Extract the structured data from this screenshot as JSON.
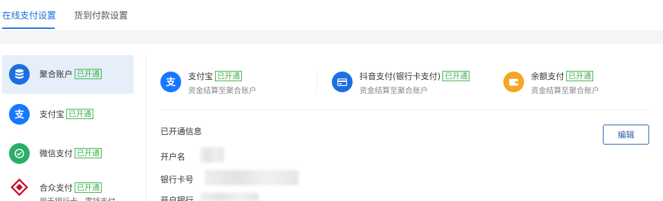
{
  "tabs": [
    {
      "label": "在线支付设置",
      "active": true
    },
    {
      "label": "货到付款设置",
      "active": false
    }
  ],
  "sidebar": {
    "items": [
      {
        "label": "聚合账户",
        "badge": "已开通",
        "icon": "aggregate-account-icon",
        "color": "#1c6fe0",
        "active": true
      },
      {
        "label": "支付宝",
        "badge": "已开通",
        "icon": "alipay-icon",
        "color": "#1677ff",
        "active": false
      },
      {
        "label": "微信支付",
        "badge": "已开通",
        "icon": "wechat-pay-icon",
        "color": "#2aae67",
        "active": false
      },
      {
        "label": "合众支付",
        "badge": "已开通",
        "icon": "hezhong-pay-icon",
        "color": "#c8102e",
        "active": false,
        "sub": "用于银行卡，零钱支付"
      }
    ]
  },
  "methods": [
    {
      "name": "支付宝",
      "badge": "已开通",
      "desc": "资金结算至聚合账户",
      "icon": "alipay-icon",
      "color": "#1677ff"
    },
    {
      "name": "抖音支付(银行卡支付)",
      "badge": "已开通",
      "desc": "资金结算至聚合账户",
      "icon": "bank-card-icon",
      "color": "#1c6fe0"
    },
    {
      "name": "余额支付",
      "badge": "已开通",
      "desc": "资金结算至聚合账户",
      "icon": "wallet-icon",
      "color": "#f5a623"
    }
  ],
  "info": {
    "title": "已开通信息",
    "edit_label": "编辑",
    "fields": [
      {
        "label": "开户名"
      },
      {
        "label": "银行卡号"
      },
      {
        "label": "开户银行"
      }
    ]
  },
  "colors": {
    "accent": "#1c6fe0",
    "badge": "#3bb14a"
  }
}
